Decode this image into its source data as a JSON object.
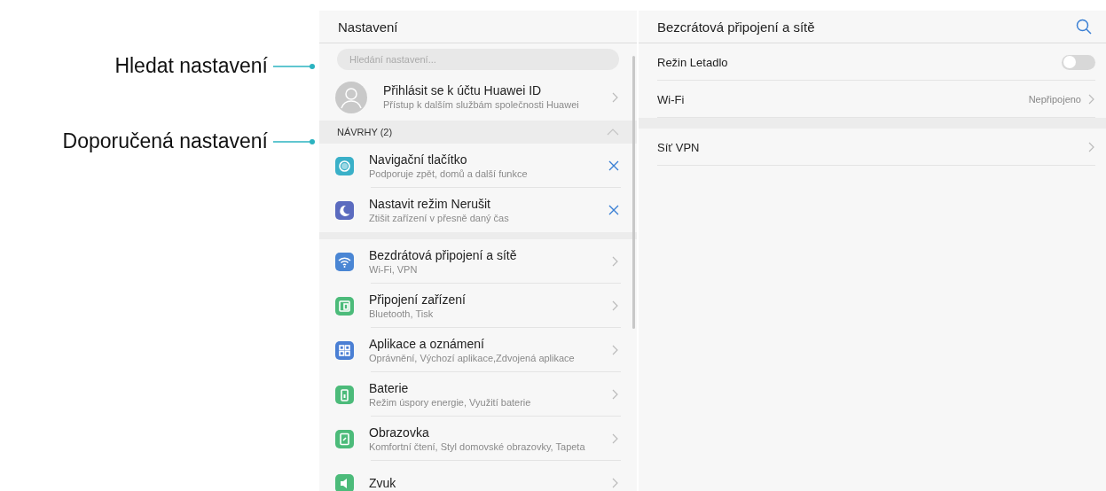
{
  "annotations": [
    {
      "text": "Hledat nastavení"
    },
    {
      "text": "Doporučená nastavení"
    }
  ],
  "left_panel": {
    "title": "Nastavení",
    "search": {
      "placeholder": "Hledání nastavení..."
    },
    "account": {
      "title": "Přihlásit se k účtu Huawei ID",
      "subtitle": "Přístup k dalším službám společnosti Huawei"
    },
    "suggestions": {
      "header": "NÁVRHY (2)",
      "expanded": true,
      "items": [
        {
          "kind": "navigation",
          "color": "#3ab0c8",
          "title": "Navigační tlačítko",
          "subtitle": "Podporuje zpět, domů a další funkce"
        },
        {
          "kind": "moon",
          "color": "#5b6bbf",
          "title": "Nastavit režim Nerušit",
          "subtitle": "Ztišit zařízení v přesně daný čas"
        }
      ]
    },
    "categories": [
      {
        "kind": "wifi",
        "color": "#4a86d4",
        "title": "Bezdrátová připojení a sítě",
        "subtitle": "Wi-Fi, VPN"
      },
      {
        "kind": "devices",
        "color": "#4cbb7a",
        "title": "Připojení zařízení",
        "subtitle": "Bluetooth, Tisk"
      },
      {
        "kind": "apps",
        "color": "#4a7fd4",
        "title": "Aplikace a oznámení",
        "subtitle": "Oprávnění, Výchozí aplikace,Zdvojená aplikace"
      },
      {
        "kind": "battery",
        "color": "#4cbb7a",
        "title": "Baterie",
        "subtitle": "Režim úspory energie, Využití baterie"
      },
      {
        "kind": "display",
        "color": "#4cbb7a",
        "title": "Obrazovka",
        "subtitle": "Komfortní čtení, Styl domovské obrazovky, Tapeta"
      },
      {
        "kind": "sound",
        "color": "#4cbb7a",
        "title": "Zvuk"
      }
    ]
  },
  "right_panel": {
    "title": "Bezcrátová připojení a sítě",
    "groups": [
      [
        {
          "kind": "toggle",
          "label": "Režin Letadlo",
          "on": false
        },
        {
          "kind": "value",
          "label": "Wi-Fi",
          "value": "Nepřipojeno"
        }
      ],
      [
        {
          "kind": "link",
          "label": "Síť VPN"
        }
      ]
    ]
  }
}
